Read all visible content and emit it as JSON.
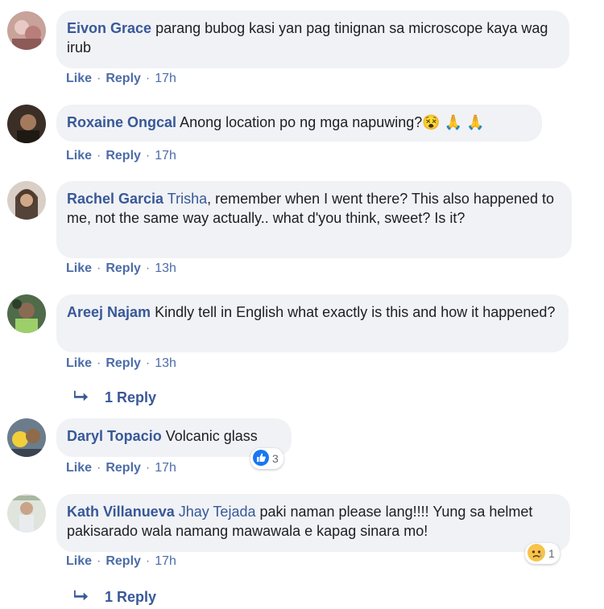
{
  "comments": [
    {
      "author": "Eivon Grace",
      "mention": "",
      "text": "parang bubog kasi yan pag tinignan sa microscope kaya wag irub",
      "like": "Like",
      "reply": "Reply",
      "time": "17h"
    },
    {
      "author": "Roxaine Ongcal",
      "mention": "",
      "text": "Anong location po ng mga napuwing?",
      "emojis": "😵 🙏 🙏",
      "like": "Like",
      "reply": "Reply",
      "time": "17h"
    },
    {
      "author": "Rachel Garcia",
      "mention": "Trisha",
      "text": ", remember when I went there? This also happened to me, not the same way actually.. what d'you think, sweet? Is it?",
      "like": "Like",
      "reply": "Reply",
      "time": "13h"
    },
    {
      "author": "Areej Najam",
      "mention": "",
      "text": "Kindly tell in English what exactly is this and how it happened?",
      "like": "Like",
      "reply": "Reply",
      "time": "13h",
      "replies_label": "1 Reply"
    },
    {
      "author": "Daryl Topacio",
      "mention": "",
      "text": "Volcanic glass",
      "like": "Like",
      "reply": "Reply",
      "time": "17h",
      "reaction_count": "3"
    },
    {
      "author": "Kath Villanueva",
      "mention": "Jhay Tejada",
      "text": "paki naman please lang!!!! Yung sa helmet pakisarado wala namang mawawala e kapag sinara mo!",
      "like": "Like",
      "reply": "Reply",
      "time": "17h",
      "reaction_count": "1",
      "replies_label": "1 Reply"
    }
  ],
  "colors": {
    "link": "#385898",
    "bubble": "#f0f2f5",
    "like_blue": "#1877f2"
  }
}
